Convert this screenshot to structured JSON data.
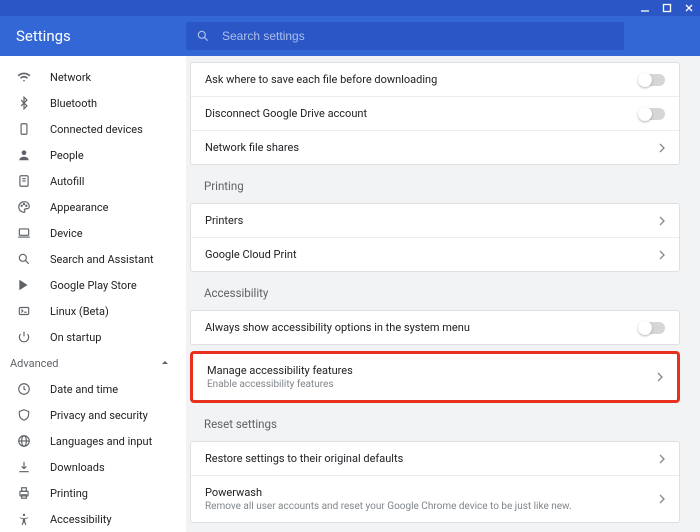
{
  "window": {
    "title": "Settings"
  },
  "search": {
    "placeholder": "Search settings"
  },
  "sidebar": {
    "main": [
      {
        "icon": "wifi-icon",
        "label": "Network"
      },
      {
        "icon": "bluetooth-icon",
        "label": "Bluetooth"
      },
      {
        "icon": "devices-icon",
        "label": "Connected devices"
      },
      {
        "icon": "person-icon",
        "label": "People"
      },
      {
        "icon": "autofill-icon",
        "label": "Autofill"
      },
      {
        "icon": "palette-icon",
        "label": "Appearance"
      },
      {
        "icon": "laptop-icon",
        "label": "Device"
      },
      {
        "icon": "search-assistant-icon",
        "label": "Search and Assistant"
      },
      {
        "icon": "play-store-icon",
        "label": "Google Play Store"
      },
      {
        "icon": "linux-icon",
        "label": "Linux (Beta)"
      },
      {
        "icon": "power-icon",
        "label": "On startup"
      }
    ],
    "advanced_header": "Advanced",
    "advanced": [
      {
        "icon": "clock-icon",
        "label": "Date and time"
      },
      {
        "icon": "shield-icon",
        "label": "Privacy and security"
      },
      {
        "icon": "globe-icon",
        "label": "Languages and input"
      },
      {
        "icon": "download-icon",
        "label": "Downloads"
      },
      {
        "icon": "printer-icon",
        "label": "Printing"
      },
      {
        "icon": "accessibility-icon",
        "label": "Accessibility"
      }
    ]
  },
  "downloads_section": {
    "ask_where": "Ask where to save each file before downloading",
    "disconnect_drive": "Disconnect Google Drive account",
    "network_shares": "Network file shares"
  },
  "printing_section": {
    "title": "Printing",
    "printers": "Printers",
    "cloud_print": "Google Cloud Print"
  },
  "accessibility_section": {
    "title": "Accessibility",
    "always_show": "Always show accessibility options in the system menu",
    "manage": "Manage accessibility features",
    "manage_sub": "Enable accessibility features"
  },
  "reset_section": {
    "title": "Reset settings",
    "restore": "Restore settings to their original defaults",
    "powerwash": "Powerwash",
    "powerwash_sub": "Remove all user accounts and reset your Google Chrome device to be just like new."
  }
}
